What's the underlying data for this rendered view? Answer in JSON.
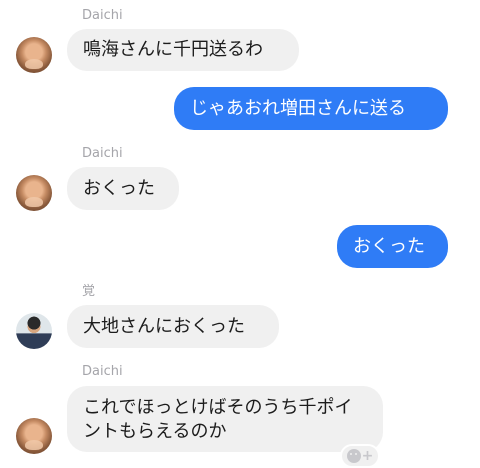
{
  "messages": [
    {
      "sender": "Daichi",
      "text": "鳴海さんに千円送るわ"
    },
    {
      "sender": "",
      "text": "じゃあおれ増田さんに送る"
    },
    {
      "sender": "Daichi",
      "text": "おくった"
    },
    {
      "sender": "",
      "text": "おくった"
    },
    {
      "sender": "覚",
      "text": "大地さんにおくった"
    },
    {
      "sender": "Daichi",
      "text": "これでほっとけばそのうち千ポイントもらえるのか"
    }
  ],
  "reaction": {
    "icon": "add-reaction-icon",
    "symbol": "+"
  },
  "colors": {
    "outgoing_bubble": "#2f7cf6",
    "incoming_bubble": "#f0f0f0",
    "sender_name": "#a5a5aa"
  }
}
